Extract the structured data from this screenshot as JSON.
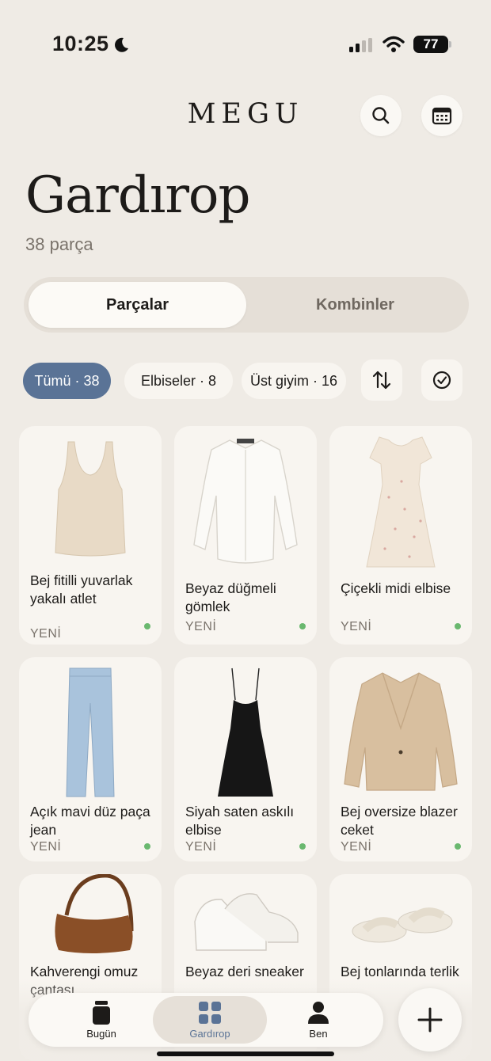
{
  "status_bar": {
    "time": "10:25",
    "battery": "77"
  },
  "header": {
    "brand": "MEGU",
    "title": "Gardırop",
    "subtitle": "38 parça"
  },
  "segments": [
    {
      "label": "Parçalar",
      "active": true
    },
    {
      "label": "Kombinler",
      "active": false
    }
  ],
  "filters": [
    {
      "label": "Tümü · 38",
      "active": true
    },
    {
      "label": "Elbiseler · 8",
      "active": false
    },
    {
      "label": "Üst giyim · 16",
      "active": false
    }
  ],
  "items": [
    {
      "name": "Bej fitilli yuvarlak yakalı atlet",
      "tag": "YENİ",
      "icon": "tank-top-icon"
    },
    {
      "name": "Beyaz düğmeli gömlek",
      "tag": "YENİ",
      "icon": "shirt-icon"
    },
    {
      "name": "Çiçekli midi elbise",
      "tag": "YENİ",
      "icon": "dress-icon"
    },
    {
      "name": "Açık mavi düz paça jean",
      "tag": "YENİ",
      "icon": "jeans-icon"
    },
    {
      "name": "Siyah saten askılı elbise",
      "tag": "YENİ",
      "icon": "slip-dress-icon"
    },
    {
      "name": "Bej oversize blazer ceket",
      "tag": "YENİ",
      "icon": "blazer-icon"
    },
    {
      "name": "Kahverengi omuz çantası",
      "tag": "",
      "icon": "bag-icon"
    },
    {
      "name": "Beyaz deri sneaker",
      "tag": "",
      "icon": "sneaker-icon"
    },
    {
      "name": "Bej tonlarında terlik",
      "tag": "",
      "icon": "slides-icon"
    }
  ],
  "tabbar": [
    {
      "label": "Bugün",
      "icon": "today-icon",
      "active": false
    },
    {
      "label": "Gardırop",
      "icon": "grid-icon",
      "active": true
    },
    {
      "label": "Ben",
      "icon": "profile-icon",
      "active": false
    }
  ],
  "colors": {
    "accent": "#5a7396",
    "background": "#efebe5",
    "card": "#f8f5f0",
    "new_dot": "#6ab86f"
  }
}
